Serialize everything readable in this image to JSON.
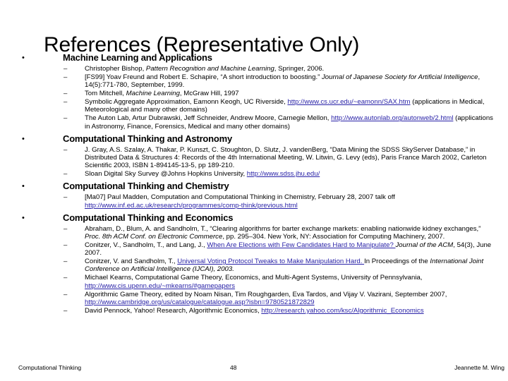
{
  "title": "References (Representative Only)",
  "sections": [
    {
      "heading": "Machine Learning and Applications",
      "refs": [
        {
          "parts": [
            {
              "t": "Christopher Bishop, "
            },
            {
              "t": "Pattern Recognition and Machine Learning",
              "i": true
            },
            {
              "t": ", Springer, 2006."
            }
          ]
        },
        {
          "parts": [
            {
              "t": "[FS99] Yoav Freund and Robert E. Schapire, “A short introduction to boosting.” "
            },
            {
              "t": "Journal of Japanese Society for Artificial Intelligence",
              "i": true
            },
            {
              "t": ", 14(5):771-780, September, 1999."
            }
          ]
        },
        {
          "parts": [
            {
              "t": "Tom Mitchell, "
            },
            {
              "t": "Machine Learning",
              "i": true
            },
            {
              "t": ", McGraw Hill, 1997"
            }
          ]
        },
        {
          "parts": [
            {
              "t": "Symbolic Aggregate Approximation, Eamonn Keogh, UC Riverside, "
            },
            {
              "t": "http://www.cs.ucr.edu/~eamonn/SAX.htm",
              "link": true
            },
            {
              "t": " (applications in Medical, Meteorological and many other domains)"
            }
          ]
        },
        {
          "parts": [
            {
              "t": "The Auton Lab, Artur Dubrawski, Jeff Schneider, Andrew Moore, Carnegie Mellon, "
            },
            {
              "t": "http://www.autonlab.org/autonweb/2.html",
              "link": true
            },
            {
              "t": " (applications in Astronomy, Finance, Forensics, Medical and many other domains)"
            }
          ]
        }
      ]
    },
    {
      "heading": "Computational Thinking and Astronomy",
      "refs": [
        {
          "parts": [
            {
              "t": "J. Gray, A.S. Szalay, A. Thakar, P. Kunszt, C. Stoughton, D. Slutz, J. vandenBerg,  “Data Mining the SDSS SkyServer Database,” in Distributed Data & Structures 4: Records of the 4th International Meeting, W. Litwin, G. Levy (eds), Paris France March 2002, Carleton Scientific 2003, ISBN 1-894145-13-5, pp 189-210."
            }
          ]
        },
        {
          "parts": [
            {
              "t": "Sloan Digital Sky Survey @Johns Hopkins University, "
            },
            {
              "t": "http://www.sdss.jhu.edu/",
              "link": true
            }
          ]
        }
      ]
    },
    {
      "heading": "Computational Thinking and Chemistry",
      "refs": [
        {
          "parts": [
            {
              "t": "[Ma07] Paul Madden, Computation and Computational Thinking in Chemistry, February 28, 2007 talk off "
            },
            {
              "t": "http://www.inf.ed.ac.uk/research/programmes/comp-think/previous.html",
              "link": true
            }
          ]
        }
      ]
    },
    {
      "heading": "Computational Thinking and Economics",
      "refs": [
        {
          "parts": [
            {
              "t": "Abraham, D., Blum, A. and Sandholm, T., “Clearing algorithms for barter exchange markets: enabling nationwide kidney exchanges,” "
            },
            {
              "t": "Proc. 8th ACM Conf. on Electronic Commerce",
              "i": true
            },
            {
              "t": ", pp. 295–304. New York, NY: Association for Computing Machinery, 2007."
            }
          ]
        },
        {
          "parts": [
            {
              "t": "Conitzer, V., Sandholm, T., and Lang, J., "
            },
            {
              "t": "When Are Elections with Few Candidates Hard to Manipulate? ",
              "link": true
            },
            {
              "t": " "
            },
            {
              "t": "Journal of the ACM",
              "i": true
            },
            {
              "t": ", 54(3), June 2007."
            }
          ]
        },
        {
          "parts": [
            {
              "t": "Conitzer, V. and Sandholm, T., "
            },
            {
              "t": "Universal Voting Protocol Tweaks to Make Manipulation Hard. ",
              "link": true
            },
            {
              "t": " In Proceedings of the "
            },
            {
              "t": "International Joint Conference on Artificial Intelligence (IJCAI), 2003.",
              "i": true
            }
          ]
        },
        {
          "parts": [
            {
              "t": "Michael Kearns, Computational Game Theory, Economics, and Multi-Agent Systems, University of Pennsylvania, "
            },
            {
              "t": "http://www.cis.upenn.edu/~mkearns/#gamepapers",
              "link": true
            }
          ]
        },
        {
          "parts": [
            {
              "t": "Algorithmic Game Theory, edited by Noam Nisan, Tim Roughgarden, Eva Tardos, and Vijay V. Vazirani, September 2007, "
            },
            {
              "t": "http://www.cambridge.org/us/catalogue/catalogue.asp?isbn=9780521872829",
              "link": true
            }
          ]
        },
        {
          "parts": [
            {
              "t": "David Pennock, Yahoo! Research, Algorithmic Economics, "
            },
            {
              "t": "http://research.yahoo.com/ksc/Algorithmic_Economics",
              "link": true
            }
          ]
        }
      ]
    }
  ],
  "glyphs": {
    "bullet": "•",
    "dash": "–"
  },
  "footer": {
    "left": "Computational Thinking",
    "center": "48",
    "right": "Jeannette M. Wing"
  },
  "colors": {
    "link": "#2a23a8",
    "text": "#000000",
    "background": "#ffffff"
  }
}
